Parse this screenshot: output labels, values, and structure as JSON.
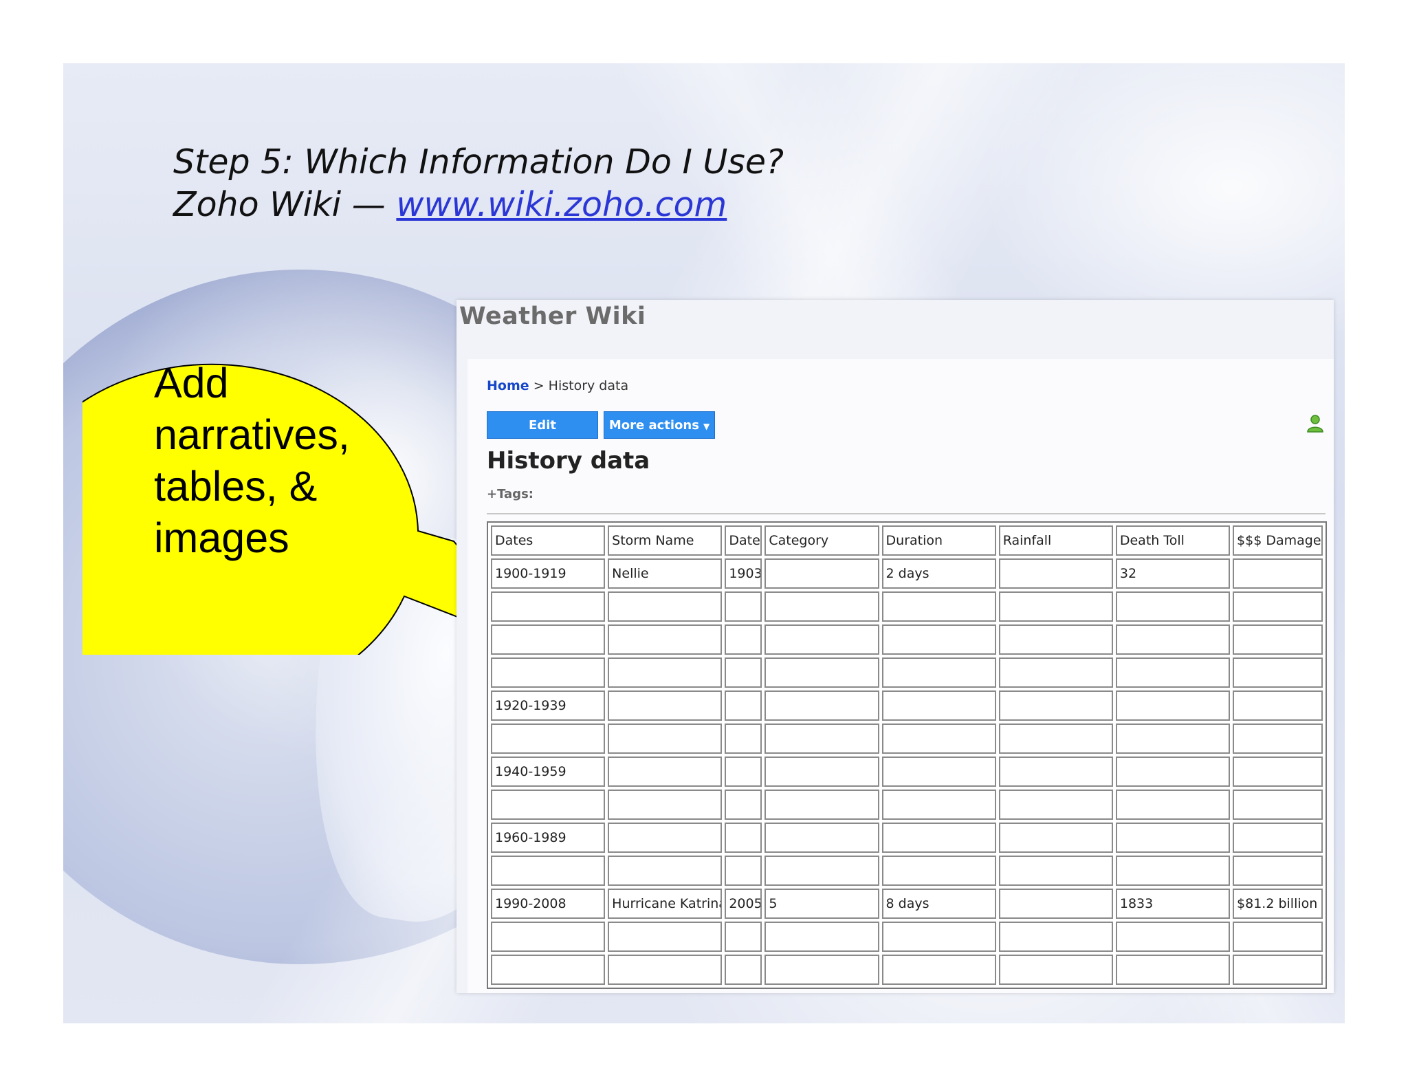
{
  "slide": {
    "title_line1": "Step 5: Which Information Do I Use?",
    "title_line2_prefix": "Zoho Wiki — ",
    "title_link": "www.wiki.zoho.com "
  },
  "callout": {
    "line1": "Add",
    "line2": "narratives,",
    "line3": "tables, &",
    "line4": "images",
    "color": "#ffff00"
  },
  "wiki": {
    "site_title": "Weather Wiki",
    "breadcrumb": {
      "home": "Home",
      "separator": ">",
      "current": "History data"
    },
    "buttons": {
      "edit": "Edit",
      "more_actions": "More actions",
      "more_actions_caret": "▼"
    },
    "page_title": "History data",
    "tags_label": "+Tags:",
    "user_icon": "user-icon",
    "accent_color": "#2f8ff0",
    "table": {
      "headers": [
        "Dates",
        "Storm Name",
        "Date",
        "Category",
        "Duration",
        "Rainfall",
        "Death Toll",
        "$$$ Damage"
      ],
      "rows": [
        [
          "1900-1919",
          "Nellie",
          "1903",
          "",
          "2 days",
          "",
          "32",
          ""
        ],
        [
          "",
          "",
          "",
          "",
          "",
          "",
          "",
          ""
        ],
        [
          "",
          "",
          "",
          "",
          "",
          "",
          "",
          ""
        ],
        [
          "",
          "",
          "",
          "",
          "",
          "",
          "",
          ""
        ],
        [
          "1920-1939",
          "",
          "",
          "",
          "",
          "",
          "",
          ""
        ],
        [
          "",
          "",
          "",
          "",
          "",
          "",
          "",
          ""
        ],
        [
          "1940-1959",
          "",
          "",
          "",
          "",
          "",
          "",
          ""
        ],
        [
          "",
          "",
          "",
          "",
          "",
          "",
          "",
          ""
        ],
        [
          "1960-1989",
          "",
          "",
          "",
          "",
          "",
          "",
          ""
        ],
        [
          "",
          "",
          "",
          "",
          "",
          "",
          "",
          ""
        ],
        [
          "1990-2008",
          "Hurricane Katrina",
          "2005",
          "5",
          "8 days",
          "",
          "1833",
          "$81.2 billion"
        ],
        [
          "",
          "",
          "",
          "",
          "",
          "",
          "",
          ""
        ],
        [
          "",
          "",
          "",
          "",
          "",
          "",
          "",
          ""
        ]
      ]
    }
  }
}
